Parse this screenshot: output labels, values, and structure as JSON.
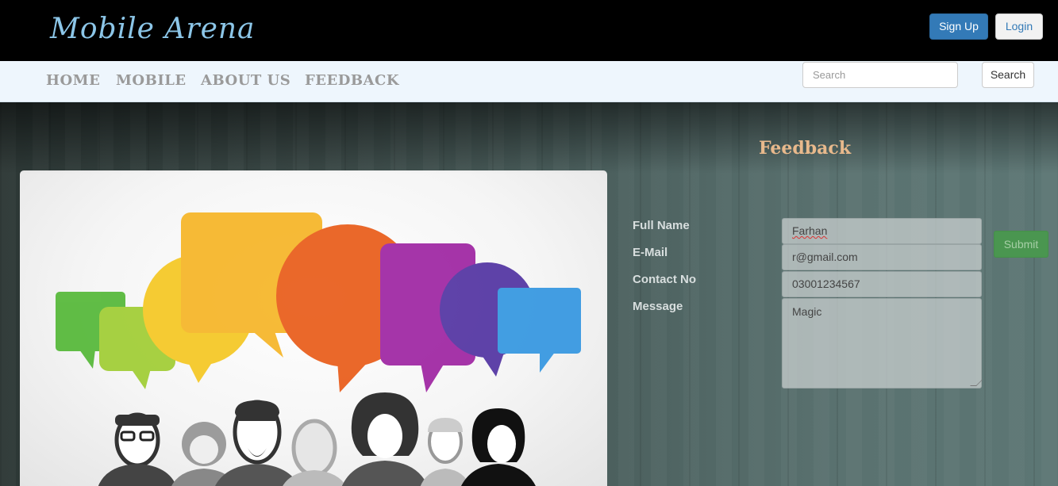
{
  "header": {
    "brand": "Mobile Arena",
    "signup_label": "Sign Up",
    "login_label": "Login"
  },
  "nav": {
    "items": [
      {
        "label": "HOME"
      },
      {
        "label": "MOBILE"
      },
      {
        "label": "ABOUT US"
      },
      {
        "label": "FEEDBACK"
      }
    ],
    "search_placeholder": "Search",
    "search_button_label": "Search"
  },
  "feedback": {
    "title": "Feedback",
    "labels": {
      "full_name": "Full Name",
      "email": "E-Mail",
      "contact": "Contact No",
      "message": "Message"
    },
    "values": {
      "full_name": "Farhan",
      "email": "r@gmail.com",
      "contact": "03001234567",
      "message": "Magic"
    },
    "submit_label": "Submit"
  },
  "colors": {
    "brand_text": "#8cc6e8",
    "primary_button": "#337ab7",
    "submit_button": "#4a9650",
    "feedback_title": "#e8b98c"
  }
}
